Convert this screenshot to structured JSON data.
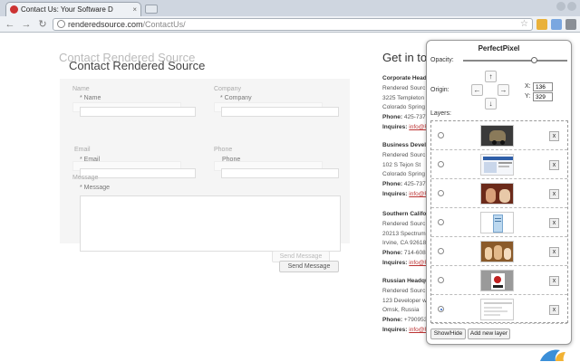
{
  "browser": {
    "tab_title": "Contact Us: Your Software D",
    "tab_close": "×",
    "url_domain": "renderedsource.com",
    "url_path": "/ContactUs/",
    "back": "←",
    "forward": "→",
    "reload": "↻",
    "star": "☆",
    "accent_color": "#2a62c9"
  },
  "page": {
    "ghost_title": "Contact Rendered Source",
    "title": "Contact Rendered Source",
    "form": {
      "name_ghost": "Name",
      "name_label": "* Name",
      "company_ghost": "Company",
      "company_label": "* Company",
      "email_ghost": "Email",
      "email_label": "* Email",
      "phone_ghost": "Phone",
      "phone_label": "Phone",
      "message_ghost": "Message",
      "message_label": "* Message",
      "send_ghost": "Send Message",
      "send_label": "Send Message"
    },
    "contact_heading": "Get in tou",
    "offices": [
      {
        "name": "Corporate Headq",
        "company": "Rendered Sourc",
        "addr1": "3225 Templeton",
        "addr2": "Colorado Spring",
        "phone_label": "Phone:",
        "phone": "425-737-",
        "inquiries_label": "Inquires:",
        "email": "info@R"
      },
      {
        "name": "Business Develo",
        "company": "Rendered Sourc",
        "addr1": "102 S Tejon St",
        "addr2": "Colorado Spring",
        "phone_label": "Phone:",
        "phone": "425-737-",
        "inquiries_label": "Inquires:",
        "email": "info@R"
      },
      {
        "name": "Southern Califor",
        "company": "Rendered Sourc",
        "addr1": "20213 Spectrum",
        "addr2": "Irvine, CA 92618",
        "phone_label": "Phone:",
        "phone": "714-608-",
        "inquiries_label": "Inquires:",
        "email": "info@R"
      },
      {
        "name": "Russian Headqu",
        "company": "Rendered Sourc",
        "addr1": "123 Developer w",
        "addr2": "Omsk, Russia",
        "phone_label": "Phone:",
        "phone": "+790953",
        "inquiries_label": "Inquires:",
        "email": "info@R"
      }
    ]
  },
  "perfectpixel": {
    "title": "PerfectPixel",
    "opacity_label": "Opacity:",
    "opacity_value": 0.68,
    "origin_label": "Origin:",
    "up": "↑",
    "down": "↓",
    "left": "←",
    "right": "→",
    "x_label": "X:",
    "x_value": "136",
    "y_label": "Y:",
    "y_value": "329",
    "layers_label": "Layers:",
    "delete_glyph": "x",
    "layers": [
      {
        "thumb": "thumb-car"
      },
      {
        "thumb": "thumb-web"
      },
      {
        "thumb": "thumb-people"
      },
      {
        "thumb": "thumb-doc"
      },
      {
        "thumb": "thumb-group"
      },
      {
        "thumb": "thumb-poster"
      },
      {
        "thumb": "thumb-page"
      }
    ],
    "selected_layer": 6,
    "show_hide": "Show/Hide",
    "add_layer": "Add new layer"
  }
}
